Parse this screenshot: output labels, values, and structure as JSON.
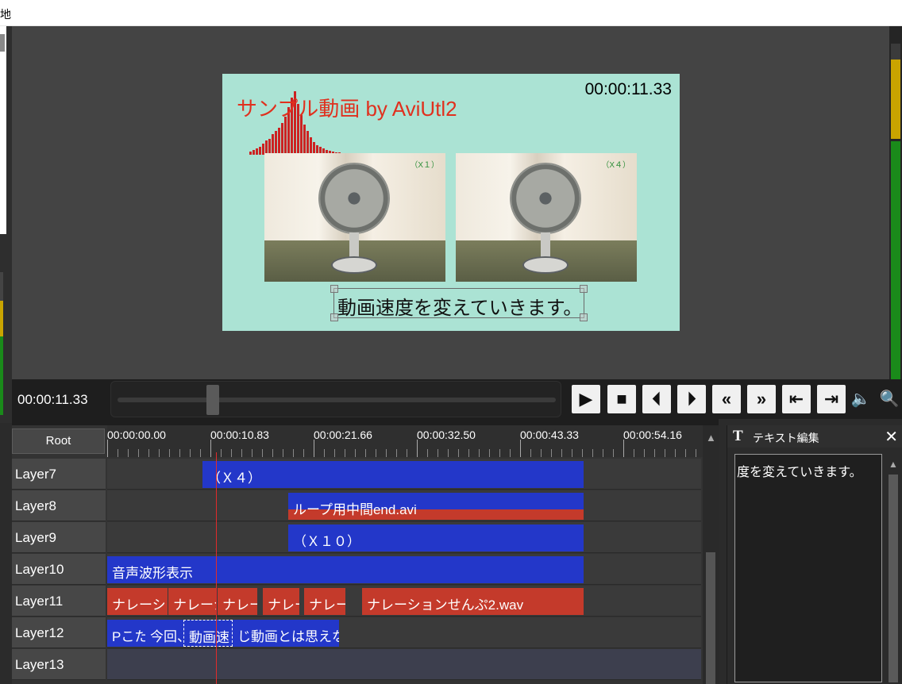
{
  "window": {
    "title_fragment": "地"
  },
  "preview": {
    "scene_title": "サンプル動画 by AviUtl2",
    "scene_time": "00:00:11.33",
    "fan_left_tag": "（X１）",
    "fan_right_tag": "（X４）",
    "caption": "動画速度を変えていきます。"
  },
  "transport": {
    "timecode": "00:00:11.33",
    "buttons": {
      "play": "▶",
      "stop": "■",
      "prev_frame": "⏴",
      "next_frame": "⏵",
      "rewind": "«",
      "fast_forward": "»",
      "to_start": "⇤",
      "to_end": "⇥",
      "volume": "🔈",
      "zoom": "🔍"
    }
  },
  "timeline": {
    "root_label": "Root",
    "ruler": [
      "00:00:00.00",
      "00:00:10.83",
      "00:00:21.66",
      "00:00:32.50",
      "00:00:43.33",
      "00:00:54.16"
    ],
    "layers": [
      {
        "label": "Layer7"
      },
      {
        "label": "Layer8"
      },
      {
        "label": "Layer9"
      },
      {
        "label": "Layer10"
      },
      {
        "label": "Layer11"
      },
      {
        "label": "Layer12"
      },
      {
        "label": "Layer13"
      }
    ],
    "clips": {
      "layer7_x4": "（Ｘ４）",
      "layer8_loop": "ループ用中間end.avi",
      "layer9_x10": "（Ｘ１０）",
      "layer10_wave": "音声波形表示",
      "layer11_a": "ナレーショ",
      "layer11_b": "ナレーシ",
      "layer11_c": "ナレーシ",
      "layer11_d": "ナレー",
      "layer11_e": "ナレー:",
      "layer11_f": "ナレーションせんぷ2.wav",
      "layer12_a": "Pこたい",
      "layer12_b": "今回、",
      "layer12_c": "動画速",
      "layer12_d": "じ動画とは思えな"
    }
  },
  "text_panel": {
    "icon": "T",
    "title": "テキスト編集",
    "close": "✕",
    "content": "度を変えていきます。"
  }
}
